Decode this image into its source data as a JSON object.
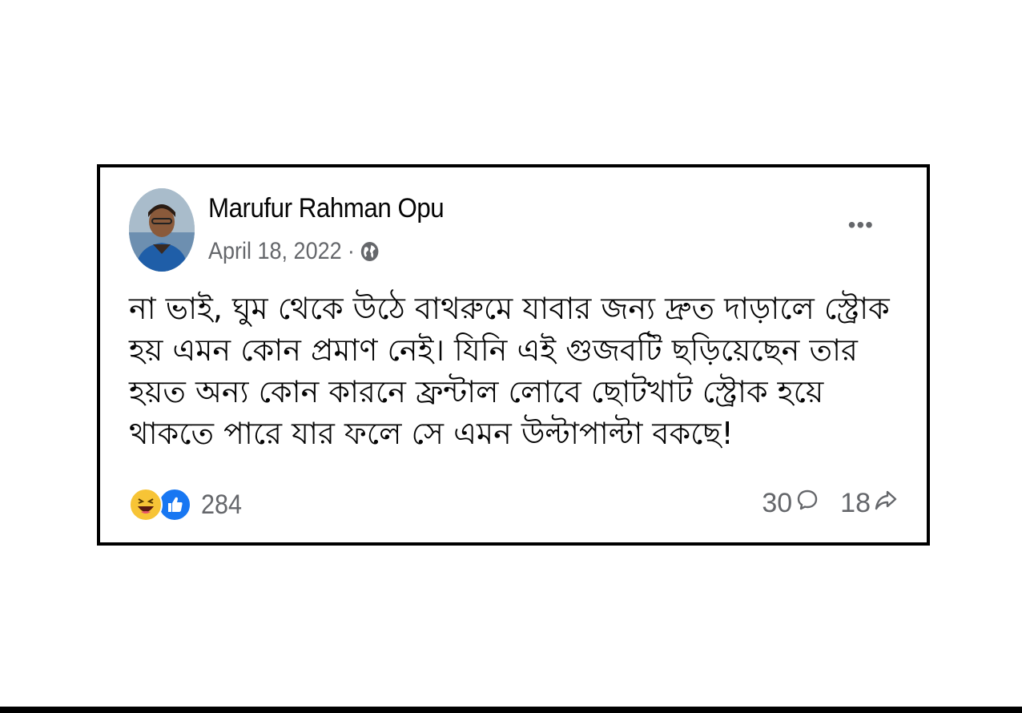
{
  "post": {
    "author": "Marufur Rahman Opu",
    "date": "April 18, 2022",
    "separator": "·",
    "privacy_icon": "globe-icon",
    "menu_icon": "more-options-icon",
    "menu_label": "•••",
    "body": "না ভাই, ঘুম থেকে উঠে বাথরুমে যাবার জন্য দ্রুত দাড়ালে স্ট্রোক হয় এমন কোন প্রমাণ নেই। যিনি এই গুজবটি ছড়িয়েছেন তার হয়ত অন্য কোন কারনে ফ্রন্টাল লোবে ছোটখাট স্ট্রোক হয়ে থাকতে পারে যার ফলে সে এমন উল্টাপাল্টা বকছে!"
  },
  "footer": {
    "reaction_icons": [
      "haha-icon",
      "like-icon"
    ],
    "reaction_count": "284",
    "comment_count": "30",
    "comment_icon": "comment-icon",
    "share_count": "18",
    "share_icon": "share-icon"
  },
  "colors": {
    "text_primary": "#050505",
    "text_secondary": "#65676b",
    "like_blue": "#1877f2",
    "haha_yellow": "#f7c436",
    "border": "#000000"
  }
}
